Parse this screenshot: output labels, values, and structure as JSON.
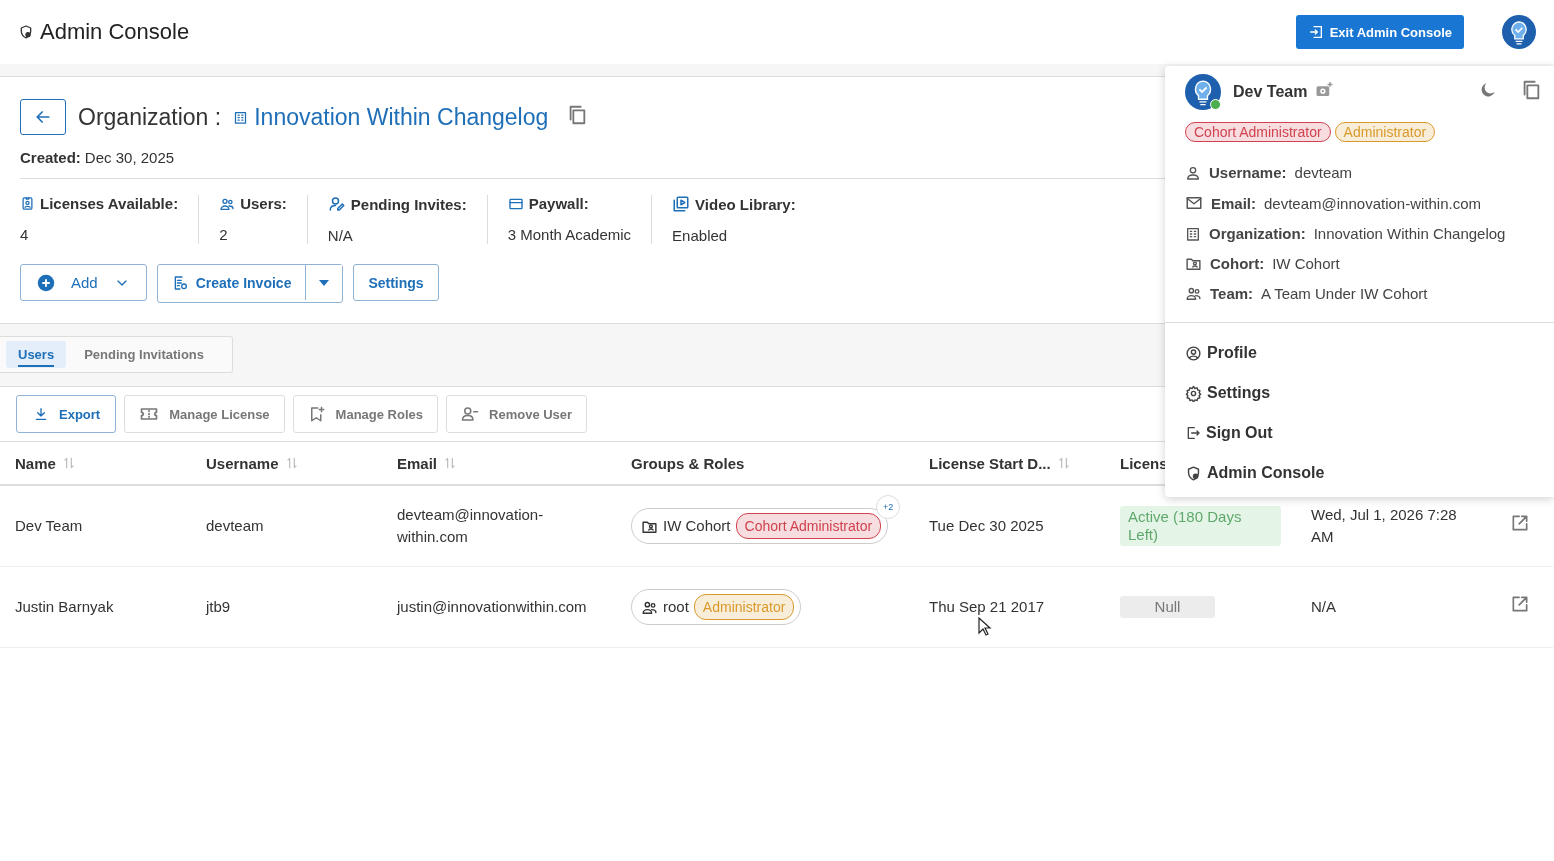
{
  "header": {
    "title": "Admin Console",
    "exit_button": "Exit Admin Console"
  },
  "organization": {
    "label": "Organization :",
    "name": "Innovation Within Changelog",
    "created_label": "Created:",
    "created_value": "Dec 30, 2025"
  },
  "stats": [
    {
      "label": "Licenses Available:",
      "value": "4"
    },
    {
      "label": "Users:",
      "value": "2"
    },
    {
      "label": "Pending Invites:",
      "value": "N/A"
    },
    {
      "label": "Paywall:",
      "value": "3 Month Academic"
    },
    {
      "label": "Video Library:",
      "value": "Enabled"
    }
  ],
  "actions": {
    "add": "Add",
    "create_invoice": "Create Invoice",
    "settings": "Settings"
  },
  "tabs": [
    {
      "label": "Users",
      "selected": true
    },
    {
      "label": "Pending Invitations",
      "selected": false
    }
  ],
  "toolbar": [
    {
      "label": "Export",
      "disabled": false
    },
    {
      "label": "Manage License",
      "disabled": true
    },
    {
      "label": "Manage Roles",
      "disabled": true
    },
    {
      "label": "Remove User",
      "disabled": true
    }
  ],
  "table": {
    "columns": [
      {
        "label": "Name",
        "sortable": true
      },
      {
        "label": "Username",
        "sortable": true
      },
      {
        "label": "Email",
        "sortable": true
      },
      {
        "label": "Groups & Roles",
        "sortable": false
      },
      {
        "label": "License Start D...",
        "sortable": true
      },
      {
        "label": "Licens"
      }
    ],
    "rows": [
      {
        "name": "Dev Team",
        "username": "devteam",
        "email": "devteam@innovation-within.com",
        "group": {
          "kind": "cohort",
          "name": "IW Cohort",
          "role": "Cohort Administrator",
          "color": "#d0424e",
          "more": "+2"
        },
        "start": "Tue Dec 30 2025",
        "license": {
          "kind": "active",
          "label": "Active (180 Days Left)"
        },
        "last": "Wed, Jul 1, 2026 7:28 AM"
      },
      {
        "name": "Justin Barnyak",
        "username": "jtb9",
        "email": "justin@innovationwithin.com",
        "group": {
          "kind": "team",
          "name": "root",
          "role": "Administrator",
          "color": "#d99a2b"
        },
        "start": "Thu Sep 21 2017",
        "license": {
          "kind": "none",
          "label": "Null"
        },
        "last": "N/A"
      }
    ]
  },
  "profile_menu": {
    "name": "Dev Team",
    "online": true,
    "roles": [
      {
        "label": "Cohort Administrator",
        "color": "#d0424e"
      },
      {
        "label": "Administrator",
        "color": "#d99a2b"
      }
    ],
    "details": [
      {
        "label": "Username:",
        "value": "devteam"
      },
      {
        "label": "Email:",
        "value": "devteam@innovation-within.com"
      },
      {
        "label": "Organization:",
        "value": "Innovation Within Changelog"
      },
      {
        "label": "Cohort:",
        "value": "IW Cohort"
      },
      {
        "label": "Team:",
        "value": "A Team Under IW Cohort"
      }
    ],
    "menu": [
      "Profile",
      "Settings",
      "Sign Out",
      "Admin Console"
    ]
  }
}
